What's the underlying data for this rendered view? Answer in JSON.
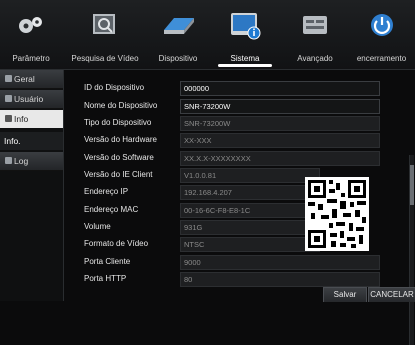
{
  "tabs": [
    {
      "label": "Parâmetro",
      "icon": "gears-icon"
    },
    {
      "label": "Pesquisa de Vídeo",
      "icon": "film-search-icon"
    },
    {
      "label": "Dispositivo",
      "icon": "harddisk-icon"
    },
    {
      "label": "Sistema",
      "icon": "system-info-icon",
      "active": true
    },
    {
      "label": "Avançado",
      "icon": "advanced-icon"
    },
    {
      "label": "encerramento",
      "icon": "power-icon"
    }
  ],
  "sidebar": {
    "items": [
      {
        "label": "Geral",
        "icon": "gear-icon"
      },
      {
        "label": "Usuário",
        "icon": "user-icon"
      },
      {
        "label": "Info",
        "icon": "info-icon"
      },
      {
        "label": "Info."
      },
      {
        "label": "Log",
        "icon": "log-icon"
      }
    ]
  },
  "info": {
    "rows": [
      {
        "label": "ID do Dispositivo",
        "value": "000000"
      },
      {
        "label": "Nome do Dispositivo",
        "value": "SNR-73200W"
      },
      {
        "label": "Tipo do Dispositivo",
        "value": "SNR-73200W"
      },
      {
        "label": "Versão do Hardware",
        "value": "XX-XXX"
      },
      {
        "label": "Versão do Software",
        "value": "XX.X.X-XXXXXXXX"
      },
      {
        "label": "Versão do IE Client",
        "value": "V1.0.0.81"
      },
      {
        "label": "Endereço IP",
        "value": "192.168.4.207"
      },
      {
        "label": "Endereço MAC",
        "value": "00-16-6C-F8-E8-1C"
      },
      {
        "label": "Volume",
        "value": "931G"
      },
      {
        "label": "Formato de Vídeo",
        "value": "NTSC"
      },
      {
        "label": "Porta Cliente",
        "value": "9000"
      },
      {
        "label": "Porta HTTP",
        "value": "80"
      }
    ]
  },
  "footer": {
    "save_label": "Salvar",
    "cancel_label": "CANCELAR"
  },
  "colors": {
    "accent": "#1f7ad1",
    "background": "#0b0b0c"
  }
}
